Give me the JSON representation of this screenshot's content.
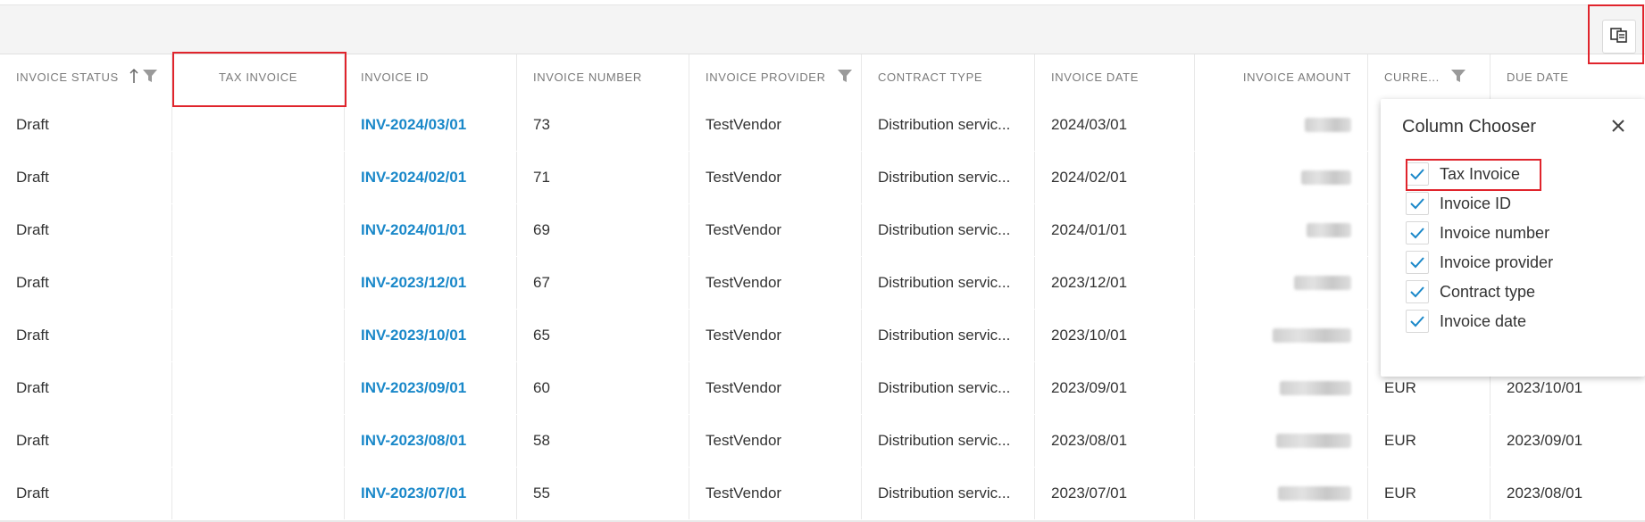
{
  "colors": {
    "accent": "#1a88c9",
    "highlight": "#e0242c"
  },
  "toolbar": {
    "chooser_icon": "column-chooser-icon"
  },
  "columns": [
    {
      "label": "INVOICE STATUS"
    },
    {
      "label": "TAX INVOICE"
    },
    {
      "label": "INVOICE ID"
    },
    {
      "label": "INVOICE NUMBER"
    },
    {
      "label": "INVOICE PROVIDER"
    },
    {
      "label": "CONTRACT TYPE"
    },
    {
      "label": "INVOICE DATE"
    },
    {
      "label": "INVOICE AMOUNT"
    },
    {
      "label": "CURRE..."
    },
    {
      "label": "DUE DATE"
    }
  ],
  "rows": [
    {
      "status": "Draft",
      "tax": "",
      "id": "INV-2024/03/01",
      "number": "73",
      "provider": "TestVendor",
      "contract": "Distribution servic...",
      "date": "2024/03/01",
      "currency": "",
      "due": ""
    },
    {
      "status": "Draft",
      "tax": "",
      "id": "INV-2024/02/01",
      "number": "71",
      "provider": "TestVendor",
      "contract": "Distribution servic...",
      "date": "2024/02/01",
      "currency": "",
      "due": ""
    },
    {
      "status": "Draft",
      "tax": "",
      "id": "INV-2024/01/01",
      "number": "69",
      "provider": "TestVendor",
      "contract": "Distribution servic...",
      "date": "2024/01/01",
      "currency": "",
      "due": ""
    },
    {
      "status": "Draft",
      "tax": "",
      "id": "INV-2023/12/01",
      "number": "67",
      "provider": "TestVendor",
      "contract": "Distribution servic...",
      "date": "2023/12/01",
      "currency": "",
      "due": ""
    },
    {
      "status": "Draft",
      "tax": "",
      "id": "INV-2023/10/01",
      "number": "65",
      "provider": "TestVendor",
      "contract": "Distribution servic...",
      "date": "2023/10/01",
      "currency": "",
      "due": ""
    },
    {
      "status": "Draft",
      "tax": "",
      "id": "INV-2023/09/01",
      "number": "60",
      "provider": "TestVendor",
      "contract": "Distribution servic...",
      "date": "2023/09/01",
      "currency": "EUR",
      "due": "2023/10/01"
    },
    {
      "status": "Draft",
      "tax": "",
      "id": "INV-2023/08/01",
      "number": "58",
      "provider": "TestVendor",
      "contract": "Distribution servic...",
      "date": "2023/08/01",
      "currency": "EUR",
      "due": "2023/09/01"
    },
    {
      "status": "Draft",
      "tax": "",
      "id": "INV-2023/07/01",
      "number": "55",
      "provider": "TestVendor",
      "contract": "Distribution servic...",
      "date": "2023/07/01",
      "currency": "EUR",
      "due": "2023/08/01"
    }
  ],
  "chooser": {
    "title": "Column Chooser",
    "options": [
      {
        "label": "Tax Invoice",
        "checked": true
      },
      {
        "label": "Invoice ID",
        "checked": true
      },
      {
        "label": "Invoice number",
        "checked": true
      },
      {
        "label": "Invoice provider",
        "checked": true
      },
      {
        "label": "Contract type",
        "checked": true
      },
      {
        "label": "Invoice date",
        "checked": true
      }
    ]
  }
}
